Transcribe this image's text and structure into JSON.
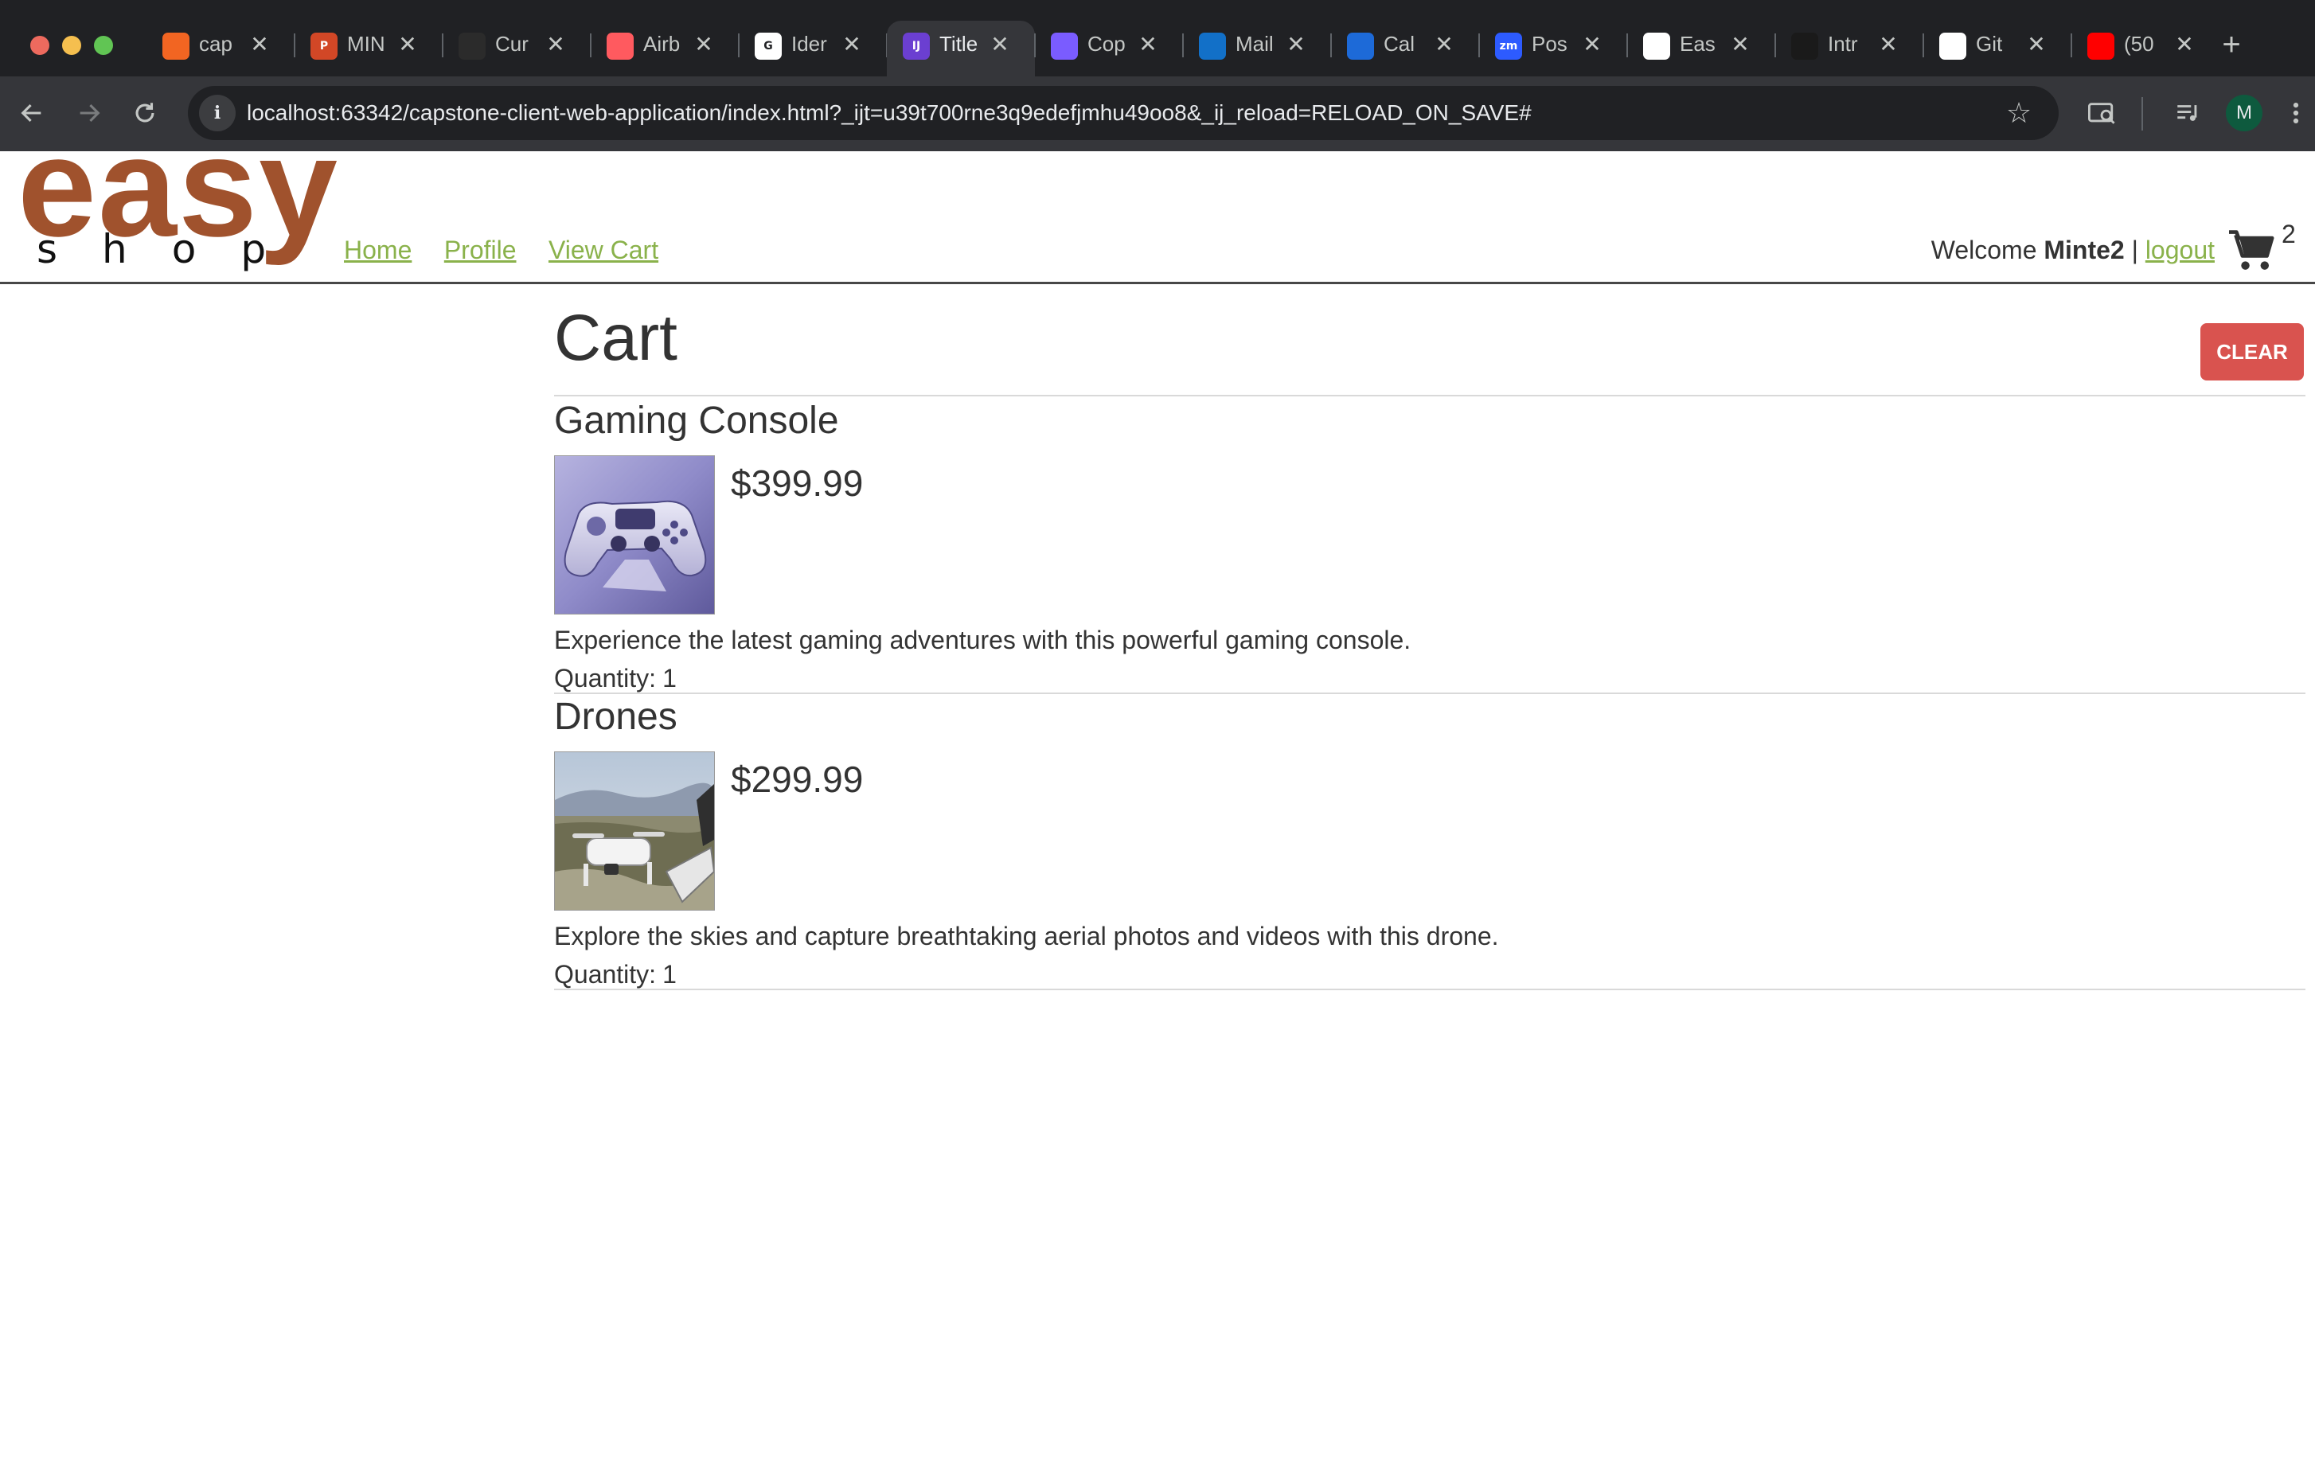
{
  "browser": {
    "tabs": [
      {
        "title": "cap",
        "icon": "sliced-page-icon",
        "color": "#f26522",
        "active": false
      },
      {
        "title": "MIN",
        "icon": "powerpoint-icon",
        "color": "#d24726",
        "active": false
      },
      {
        "title": "Cur",
        "icon": "cube-icon",
        "color": "#2b2b2b",
        "active": false
      },
      {
        "title": "Airb",
        "icon": "airbnb-icon",
        "color": "#ff5a5f",
        "active": false
      },
      {
        "title": "Ider",
        "icon": "google-icon",
        "color": "#ffffff",
        "active": false
      },
      {
        "title": "Title",
        "icon": "intellij-icon",
        "color": "#6b3fd1",
        "active": true
      },
      {
        "title": "Cop",
        "icon": "copilot-icon",
        "color": "#7a5cff",
        "active": false
      },
      {
        "title": "Mail",
        "icon": "outlook-icon",
        "color": "#1270c8",
        "active": false
      },
      {
        "title": "Cal",
        "icon": "calendar-icon",
        "color": "#1d6ad8",
        "active": false
      },
      {
        "title": "Pos",
        "icon": "zoom-icon",
        "color": "#2d5bff",
        "active": false
      },
      {
        "title": "Eas",
        "icon": "github-icon",
        "color": "#ffffff",
        "active": false
      },
      {
        "title": "Intr",
        "icon": "openai-icon",
        "color": "#1a1a1a",
        "active": false
      },
      {
        "title": "Git",
        "icon": "openai-icon",
        "color": "#ffffff",
        "active": false
      },
      {
        "title": "(50",
        "icon": "youtube-icon",
        "color": "#ff0000",
        "active": false
      }
    ],
    "favicon_letters": {
      "google": "G",
      "zoom": "zm",
      "intellij": "IJ",
      "powerpoint": "P"
    },
    "close_glyph": "✕",
    "new_tab_glyph": "+",
    "url": "localhost:63342/capstone-client-web-application/index.html?_ijt=u39t700rne3q9edefjmhu49oo8&_ij_reload=RELOAD_ON_SAVE#",
    "site_info_glyph": "i",
    "bookmark_glyph": "☆",
    "profile_initial": "M"
  },
  "site": {
    "logo_top": "easy",
    "logo_bottom": "shop",
    "nav": {
      "home": "Home",
      "profile": "Profile",
      "view_cart": "View Cart"
    },
    "welcome_text": "Welcome",
    "username": "Minte2",
    "separator": "|",
    "logout": "logout",
    "cart_count": "2"
  },
  "cart": {
    "title": "Cart",
    "clear_label": "CLEAR",
    "quantity_label": "Quantity:",
    "items": [
      {
        "name": "Gaming Console",
        "price": "$399.99",
        "description": "Experience the latest gaming adventures with this powerful gaming console.",
        "quantity": "1"
      },
      {
        "name": "Drones",
        "price": "$299.99",
        "description": "Explore the skies and capture breathtaking aerial photos and videos with this drone.",
        "quantity": "1"
      }
    ]
  },
  "colors": {
    "brand": "#a0522d",
    "nav_link": "#8ab24b",
    "clear_button": "#d9534f",
    "chrome_dark": "#202124",
    "chrome_toolbar": "#35363a"
  }
}
